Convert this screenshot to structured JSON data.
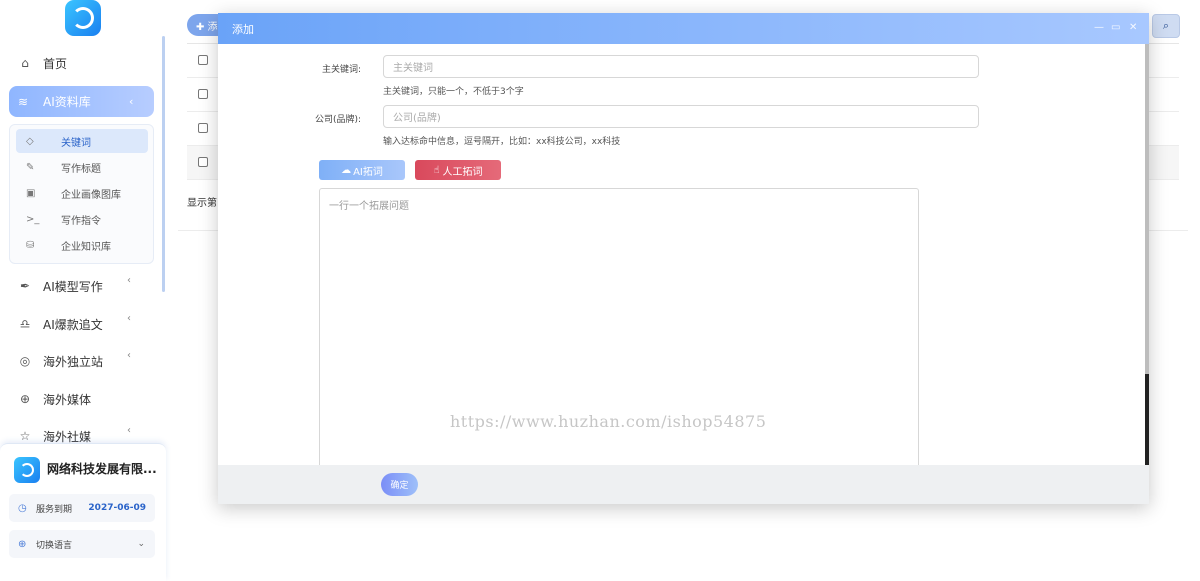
{
  "sidebar": {
    "nav": [
      {
        "label": "首页",
        "icon": "home-icon"
      },
      {
        "label": "AI资料库",
        "icon": "layers-icon",
        "active": true
      },
      {
        "label": "AI模型写作",
        "icon": "pen-icon"
      },
      {
        "label": "AI爆款追文",
        "icon": "bell-icon"
      },
      {
        "label": "海外独立站",
        "icon": "compass-icon"
      },
      {
        "label": "海外媒体",
        "icon": "globe-icon"
      },
      {
        "label": "海外社媒",
        "icon": "star-icon"
      }
    ],
    "subnav": [
      {
        "label": "关键词",
        "icon": "tag-icon",
        "active": true
      },
      {
        "label": "写作标题",
        "icon": "feather-icon"
      },
      {
        "label": "企业画像图库",
        "icon": "image-icon"
      },
      {
        "label": "写作指令",
        "icon": "terminal-icon"
      },
      {
        "label": "企业知识库",
        "icon": "database-icon"
      }
    ]
  },
  "company": {
    "name": "网络科技发展有限...",
    "service_label": "服务到期",
    "service_date": "2027-06-09",
    "language_label": "切换语言"
  },
  "background": {
    "add_label": "✚ 添",
    "footer_text": "显示第"
  },
  "dialog": {
    "title": "添加",
    "keyword_label": "主关键词:",
    "keyword_placeholder": "主关键词",
    "keyword_hint": "主关键词，只能一个，不低于3个字",
    "company_label": "公司(品牌):",
    "company_placeholder": "公司(品牌)",
    "company_hint": "输入达标命中信息，逗号隔开，比如：xx科技公司，xx科技",
    "ai_button": "AI拓词",
    "manual_button": "人工拓词",
    "textarea_placeholder": "一行一个拓展问题",
    "confirm_button": "确定"
  },
  "watermark": "https://www.huzhan.com/ishop54875",
  "colors": {
    "accent": "#6aa3f8",
    "danger": "#d9495c",
    "link": "#2a63c9"
  }
}
